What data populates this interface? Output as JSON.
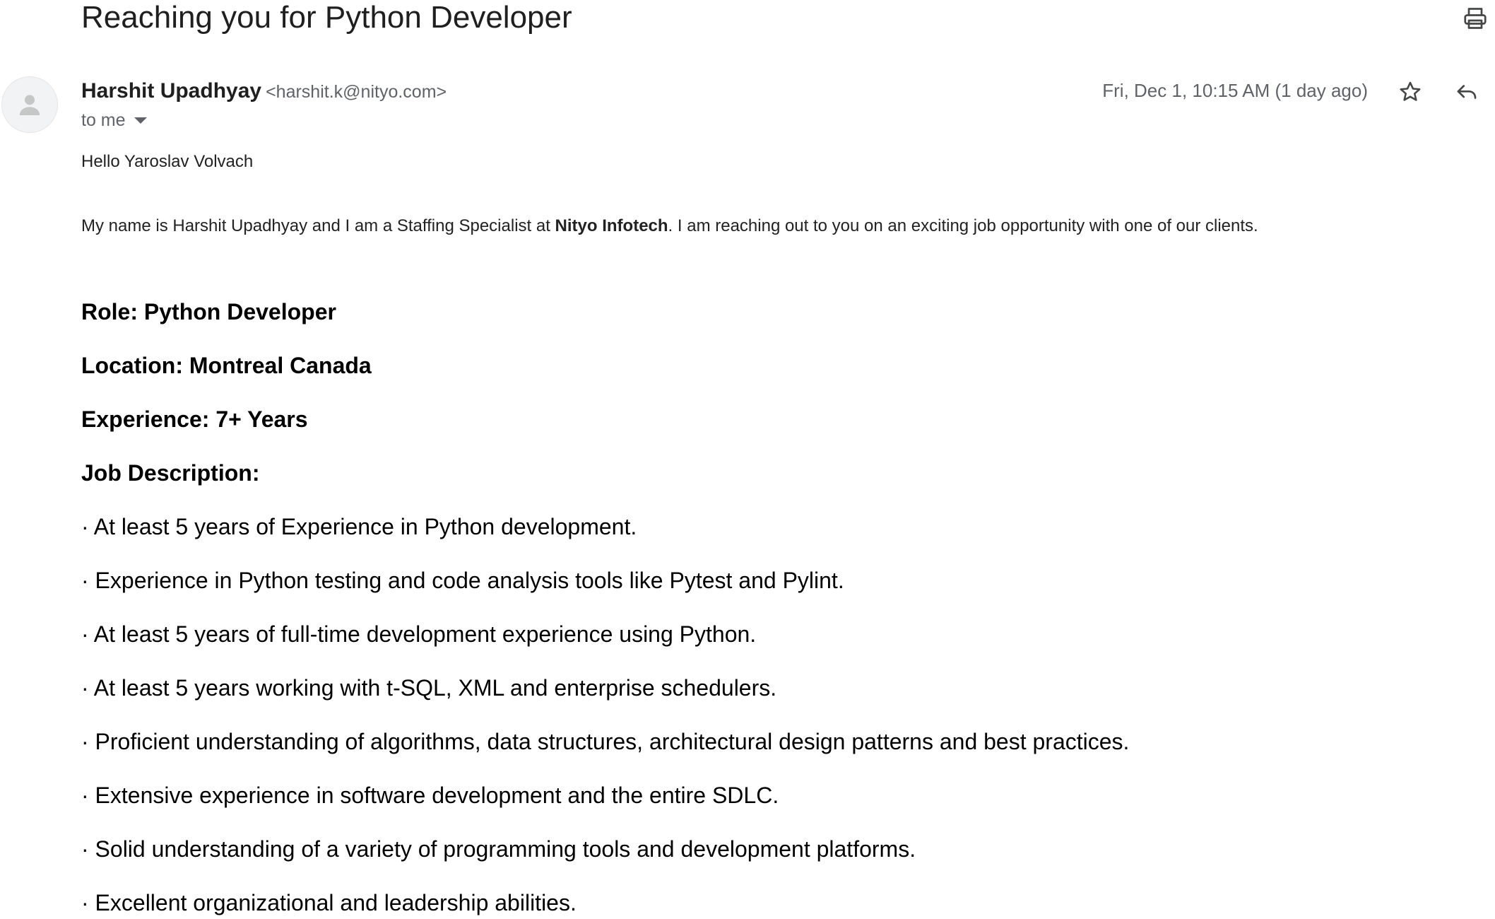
{
  "email": {
    "subject": "Reaching you for Python Developer",
    "sender_name": "Harshit Upadhyay",
    "sender_email": "<harshit.k@nityo.com>",
    "recipient_label": "to me",
    "date": "Fri, Dec 1, 10:15 AM (1 day ago)"
  },
  "icons": {
    "print": "printer-icon",
    "star": "star-outline-icon",
    "reply": "reply-icon",
    "avatar": "default-person-icon"
  },
  "body": {
    "greeting": "Hello Yaroslav Volvach",
    "intro_before": "My name is Harshit Upadhyay and I am a Staffing Specialist at ",
    "intro_company": "Nityo Infotech",
    "intro_after": ". I am reaching out to you on an exciting job opportunity with one of our clients.",
    "role": "Role: Python Developer",
    "location": "Location: Montreal Canada",
    "experience": "Experience: 7+ Years",
    "jd_heading": "Job Description:",
    "requirements": [
      "· At least 5 years of Experience in Python development.",
      "· Experience in Python testing and code analysis tools like Pytest and Pylint.",
      "· At least 5 years of full-time development experience using Python.",
      "· At least 5 years working with t-SQL, XML and enterprise schedulers.",
      "· Proficient understanding of algorithms, data structures, architectural design patterns and best practices.",
      "· Extensive experience in software development and the entire SDLC.",
      "· Solid understanding of a variety of programming tools and development platforms.",
      "· Excellent organizational and leadership abilities."
    ]
  }
}
